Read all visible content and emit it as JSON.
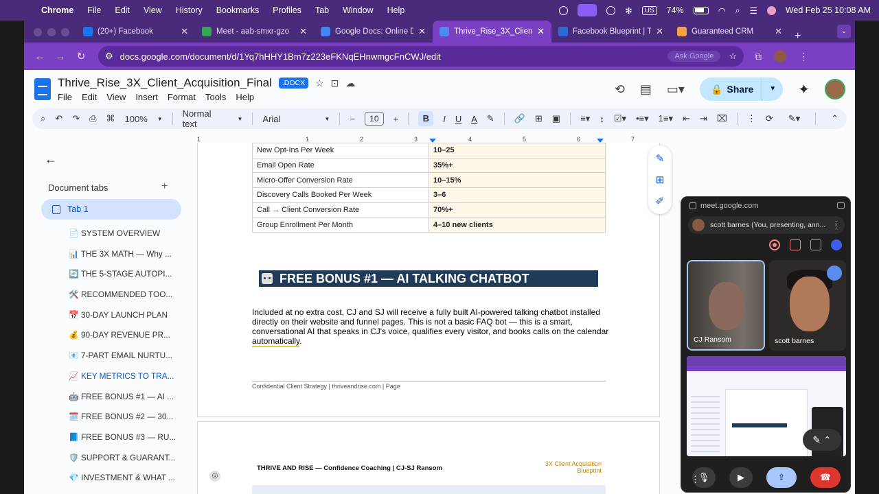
{
  "menubar": {
    "app": "Chrome",
    "items": [
      "File",
      "Edit",
      "View",
      "History",
      "Bookmarks",
      "Profiles",
      "Tab",
      "Window",
      "Help"
    ],
    "keyboard": "US",
    "battery": "74%",
    "battery_level": 0.74,
    "datetime": "Wed Feb 25  10:08 AM"
  },
  "tabs": [
    {
      "title": "(20+) Facebook",
      "color": "#1877f2"
    },
    {
      "title": "Meet - aab-smxr-gzo",
      "color": "#34a853"
    },
    {
      "title": "Google Docs: Online Doc",
      "color": "#4285f4"
    },
    {
      "title": "Thrive_Rise_3X_Client_Acq",
      "color": "#4c8bf5"
    },
    {
      "title": "Facebook Blueprint | Tre",
      "color": "#2d6bd6"
    },
    {
      "title": "Guaranteed CRM",
      "color": "#f4a340"
    }
  ],
  "active_tab_index": 3,
  "omnibox": {
    "url": "docs.google.com/document/d/1Yq7hHHY1Bm7z223eFKNqEHnwmgcFnCWJ/edit",
    "ask": "Ask Google"
  },
  "docs": {
    "title": "Thrive_Rise_3X_Client_Acquisition_Final",
    "badge": ".DOCX",
    "menus": [
      "File",
      "Edit",
      "View",
      "Insert",
      "Format",
      "Tools",
      "Help"
    ],
    "share": "Share",
    "zoom": "100%",
    "style": "Normal text",
    "font": "Arial",
    "font_size": "10",
    "ruler": [
      "1",
      "1",
      "2",
      "3",
      "4",
      "5",
      "6",
      "7"
    ]
  },
  "outline": {
    "back": "←",
    "label": "Document tabs",
    "tab": "Tab 1",
    "items": [
      "📄 SYSTEM OVERVIEW",
      "📊 THE 3X MATH — Why ...",
      "🔄 THE 5-STAGE AUTOPI...",
      "🛠️ RECOMMENDED TOO...",
      "📅 30-DAY LAUNCH PLAN",
      "💰 90-DAY REVENUE PR...",
      "📧 7-PART EMAIL NURTU...",
      "📈 KEY METRICS TO TRA...",
      "🤖 FREE BONUS #1 — AI ...",
      "🗓️ FREE BONUS #2 — 30...",
      "📘 FREE BONUS #3 — RU...",
      "🛡️ SUPPORT & GUARANT...",
      "💎 INVESTMENT & WHAT ..."
    ],
    "current_index": 7
  },
  "metrics": [
    {
      "label": "New Opt-Ins Per Week",
      "value": "10–25"
    },
    {
      "label": "Email Open Rate",
      "value": "35%+"
    },
    {
      "label": "Micro-Offer Conversion Rate",
      "value": "10–15%"
    },
    {
      "label": "Discovery Calls Booked Per Week",
      "value": "3–6"
    },
    {
      "label": "Call → Client Conversion Rate",
      "value": "70%+"
    },
    {
      "label": "Group Enrollment Per Month",
      "value": "4–10 new clients"
    }
  ],
  "bonus": {
    "heading": "FREE BONUS #1 — AI TALKING CHATBOT",
    "para_a": "Included at no extra cost, CJ and SJ will receive a fully built AI-powered talking chatbot installed directly on their website and funnel pages. This is not a basic FAQ bot — this is a smart, conversational AI that speaks in CJ's voice, qualifies every visitor, and books calls on the calendar ",
    "para_b": "automatically",
    "para_c": "."
  },
  "footer": "Confidential Client Strategy | thriveandrise.com  |  Page",
  "page2": {
    "header": "THRIVE AND RISE — Confidence Coaching | CJ-SJ Ransom",
    "right": "3X Client Acquisition Blueprint"
  },
  "meet": {
    "url": "meet.google.com",
    "presenting": "scott barnes (You, presenting, ann...",
    "p1": "CJ Ransom",
    "p2": "scott barnes"
  }
}
